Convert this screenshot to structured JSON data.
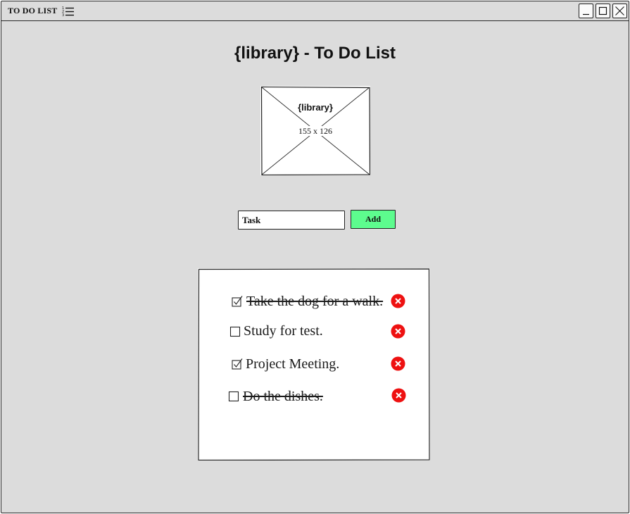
{
  "window": {
    "title": "TO DO LIST",
    "icon": "numbered-list-icon",
    "controls": {
      "minimize": "minimize-icon",
      "maximize": "maximize-icon",
      "close": "close-icon"
    }
  },
  "page": {
    "title": "{library} - To Do List"
  },
  "image_placeholder": {
    "label": "{library}",
    "size_text": "155 x 126"
  },
  "add_task": {
    "input_value": "Task",
    "button_label": "Add",
    "button_color": "#5dfc8e"
  },
  "tasks": [
    {
      "text": "Take the dog for a walk.",
      "checked": true,
      "struck_through": true
    },
    {
      "text": "Study for test.",
      "checked": false,
      "struck_through": false
    },
    {
      "text": "Project Meeting.",
      "checked": true,
      "struck_through": false
    },
    {
      "text": "Do the dishes.",
      "checked": false,
      "struck_through": true
    }
  ],
  "colors": {
    "window_background": "#dcdcdc",
    "delete_button": "#ee1111"
  }
}
